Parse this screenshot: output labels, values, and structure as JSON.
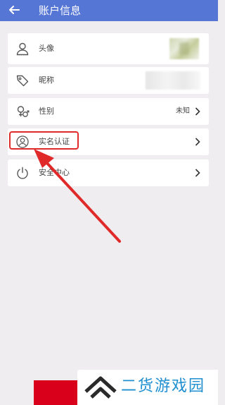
{
  "header": {
    "title": "账户信息",
    "back_icon": "back-arrow-icon"
  },
  "rows": [
    {
      "label": "头像",
      "icon": "person-icon"
    },
    {
      "label": "昵称",
      "icon": "tag-icon"
    },
    {
      "label": "性别",
      "icon": "gender-icon",
      "value": "未知"
    },
    {
      "label": "实名认证",
      "icon": "id-verify-icon"
    },
    {
      "label": "安全中心",
      "icon": "power-icon"
    }
  ],
  "annotation": {
    "color": "#e02a2a"
  },
  "watermark": {
    "text": "二货游戏园"
  },
  "colors": {
    "header": "#5676d6",
    "background": "#efedf0",
    "accent_red": "#d9001b",
    "watermark_blue": "#1f8fd0"
  }
}
